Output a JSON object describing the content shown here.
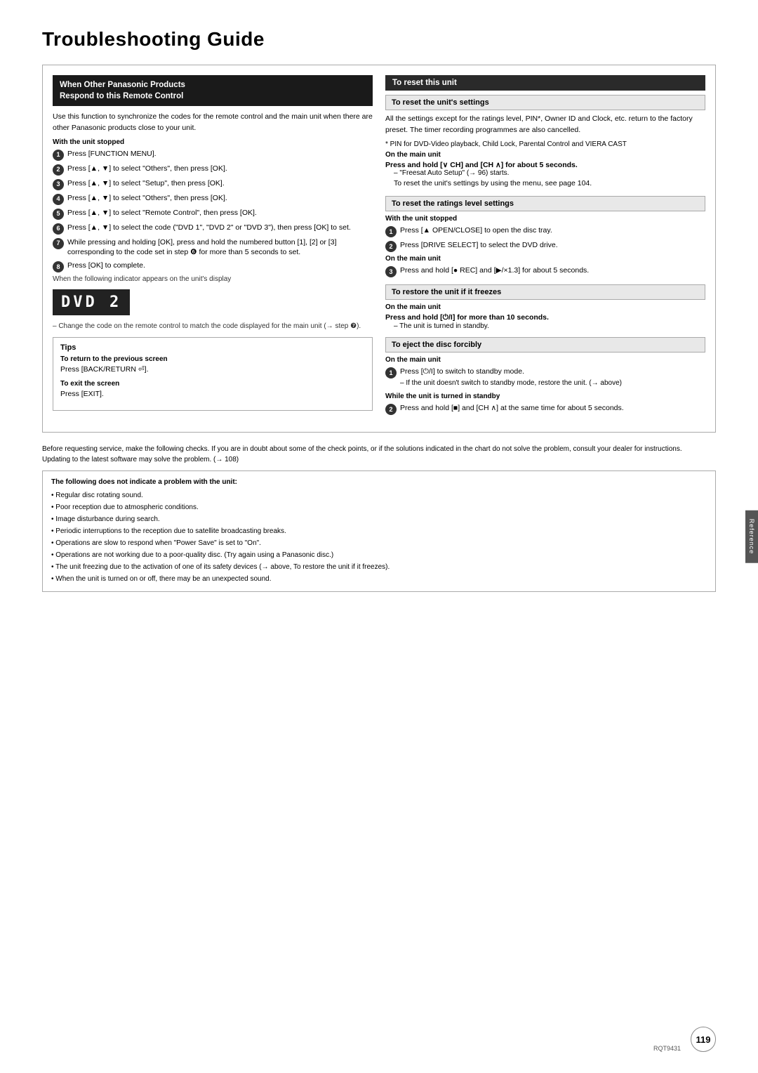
{
  "page": {
    "title": "Troubleshooting Guide",
    "page_number": "119",
    "model_code": "RQT9431",
    "reference_tab": "Reference"
  },
  "left": {
    "panel_title_line1": "When Other Panasonic Products",
    "panel_title_line2": "Respond to this Remote Control",
    "intro_text": "Use this function to synchronize the codes for the remote control and the main unit when there are other Panasonic products close to your unit.",
    "with_unit_stopped": "With the unit stopped",
    "steps": [
      "Press [FUNCTION MENU].",
      "Press [▲, ▼] to select \"Others\", then press [OK].",
      "Press [▲, ▼] to select \"Setup\", then press [OK].",
      "Press [▲, ▼] to select \"Others\", then press [OK].",
      "Press [▲, ▼] to select \"Remote Control\", then press [OK].",
      "Press [▲, ▼] to select the code (\"DVD 1\", \"DVD 2\" or \"DVD 3\"), then press [OK] to set.",
      "While pressing and holding [OK], press and hold the numbered button [1], [2] or [3] corresponding to the code set in step ❻ for more than 5 seconds to set.",
      "Press [OK] to complete."
    ],
    "display_text": "DVD 2",
    "display_note": "When the following indicator appears on the unit's display",
    "change_note": "– Change the code on the remote control to match the code displayed for the main unit (→ step ❼).",
    "tips_title": "Tips",
    "tips_return_label": "To return to the previous screen",
    "tips_return_text": "Press [BACK/RETURN ⏎].",
    "tips_exit_label": "To exit the screen",
    "tips_exit_text": "Press [EXIT]."
  },
  "right": {
    "reset_title": "To reset this unit",
    "subsection1_title": "To reset the unit's settings",
    "subsection1_body": "All the settings except for the ratings level, PIN*, Owner ID and Clock, etc. return to the factory preset. The timer recording programmes are also cancelled.",
    "subsection1_asterisk": "* PIN for DVD-Video playback, Child Lock, Parental Control and VIERA CAST",
    "on_main_unit": "On the main unit",
    "reset_unit_instruction": "Press and hold [∨ CH] and [CH ∧] for about 5 seconds.",
    "freesat_note": "– \"Freesat Auto Setup\" (→ 96) starts.",
    "reset_menu_note": "To reset the unit's settings by using the menu, see page 104.",
    "subsection2_title": "To reset the ratings level settings",
    "with_unit_stopped": "With the unit stopped",
    "ratings_steps": [
      "Press [▲ OPEN/CLOSE] to open the disc tray.",
      "Press [DRIVE SELECT] to select the DVD drive."
    ],
    "on_main_unit2": "On the main unit",
    "ratings_step3": "Press and hold [● REC] and [▶/×1.3] for about 5 seconds.",
    "subsection3_title": "To restore the unit if it freezes",
    "on_main_unit3": "On the main unit",
    "freeze_instruction": "Press and hold [⏻/I] for more than 10 seconds.",
    "freeze_note": "– The unit is turned in standby.",
    "subsection4_title": "To eject the disc forcibly",
    "on_main_unit4": "On the main unit",
    "eject_steps": [
      "Press [⏻/I] to switch to standby mode.",
      "Press and hold [■] and [CH ∧] at the same time for about 5 seconds."
    ],
    "eject_if_note": "– If the unit doesn't switch to standby mode, restore the unit. (→ above)",
    "while_standby": "While the unit is turned in standby"
  },
  "bottom": {
    "before_text": "Before requesting service, make the following checks. If you are in doubt about some of the check points, or if the solutions indicated in the chart do not solve the problem, consult your dealer for instructions.",
    "update_note": "Updating to the latest software may solve the problem. (→ 108)",
    "warning_title": "The following does not indicate a problem with the unit:",
    "warning_items": [
      "Regular disc rotating sound.",
      "Poor reception due to atmospheric conditions.",
      "Image disturbance during search.",
      "Periodic interruptions to the reception due to satellite broadcasting breaks.",
      "Operations are slow to respond when \"Power Save\" is set to \"On\".",
      "Operations are not working due to a poor-quality disc. (Try again using a Panasonic disc.)",
      "The unit freezing due to the activation of one of its safety devices (→ above, To restore the unit if it freezes).",
      "When the unit is turned on or off, there may be an unexpected sound."
    ]
  }
}
